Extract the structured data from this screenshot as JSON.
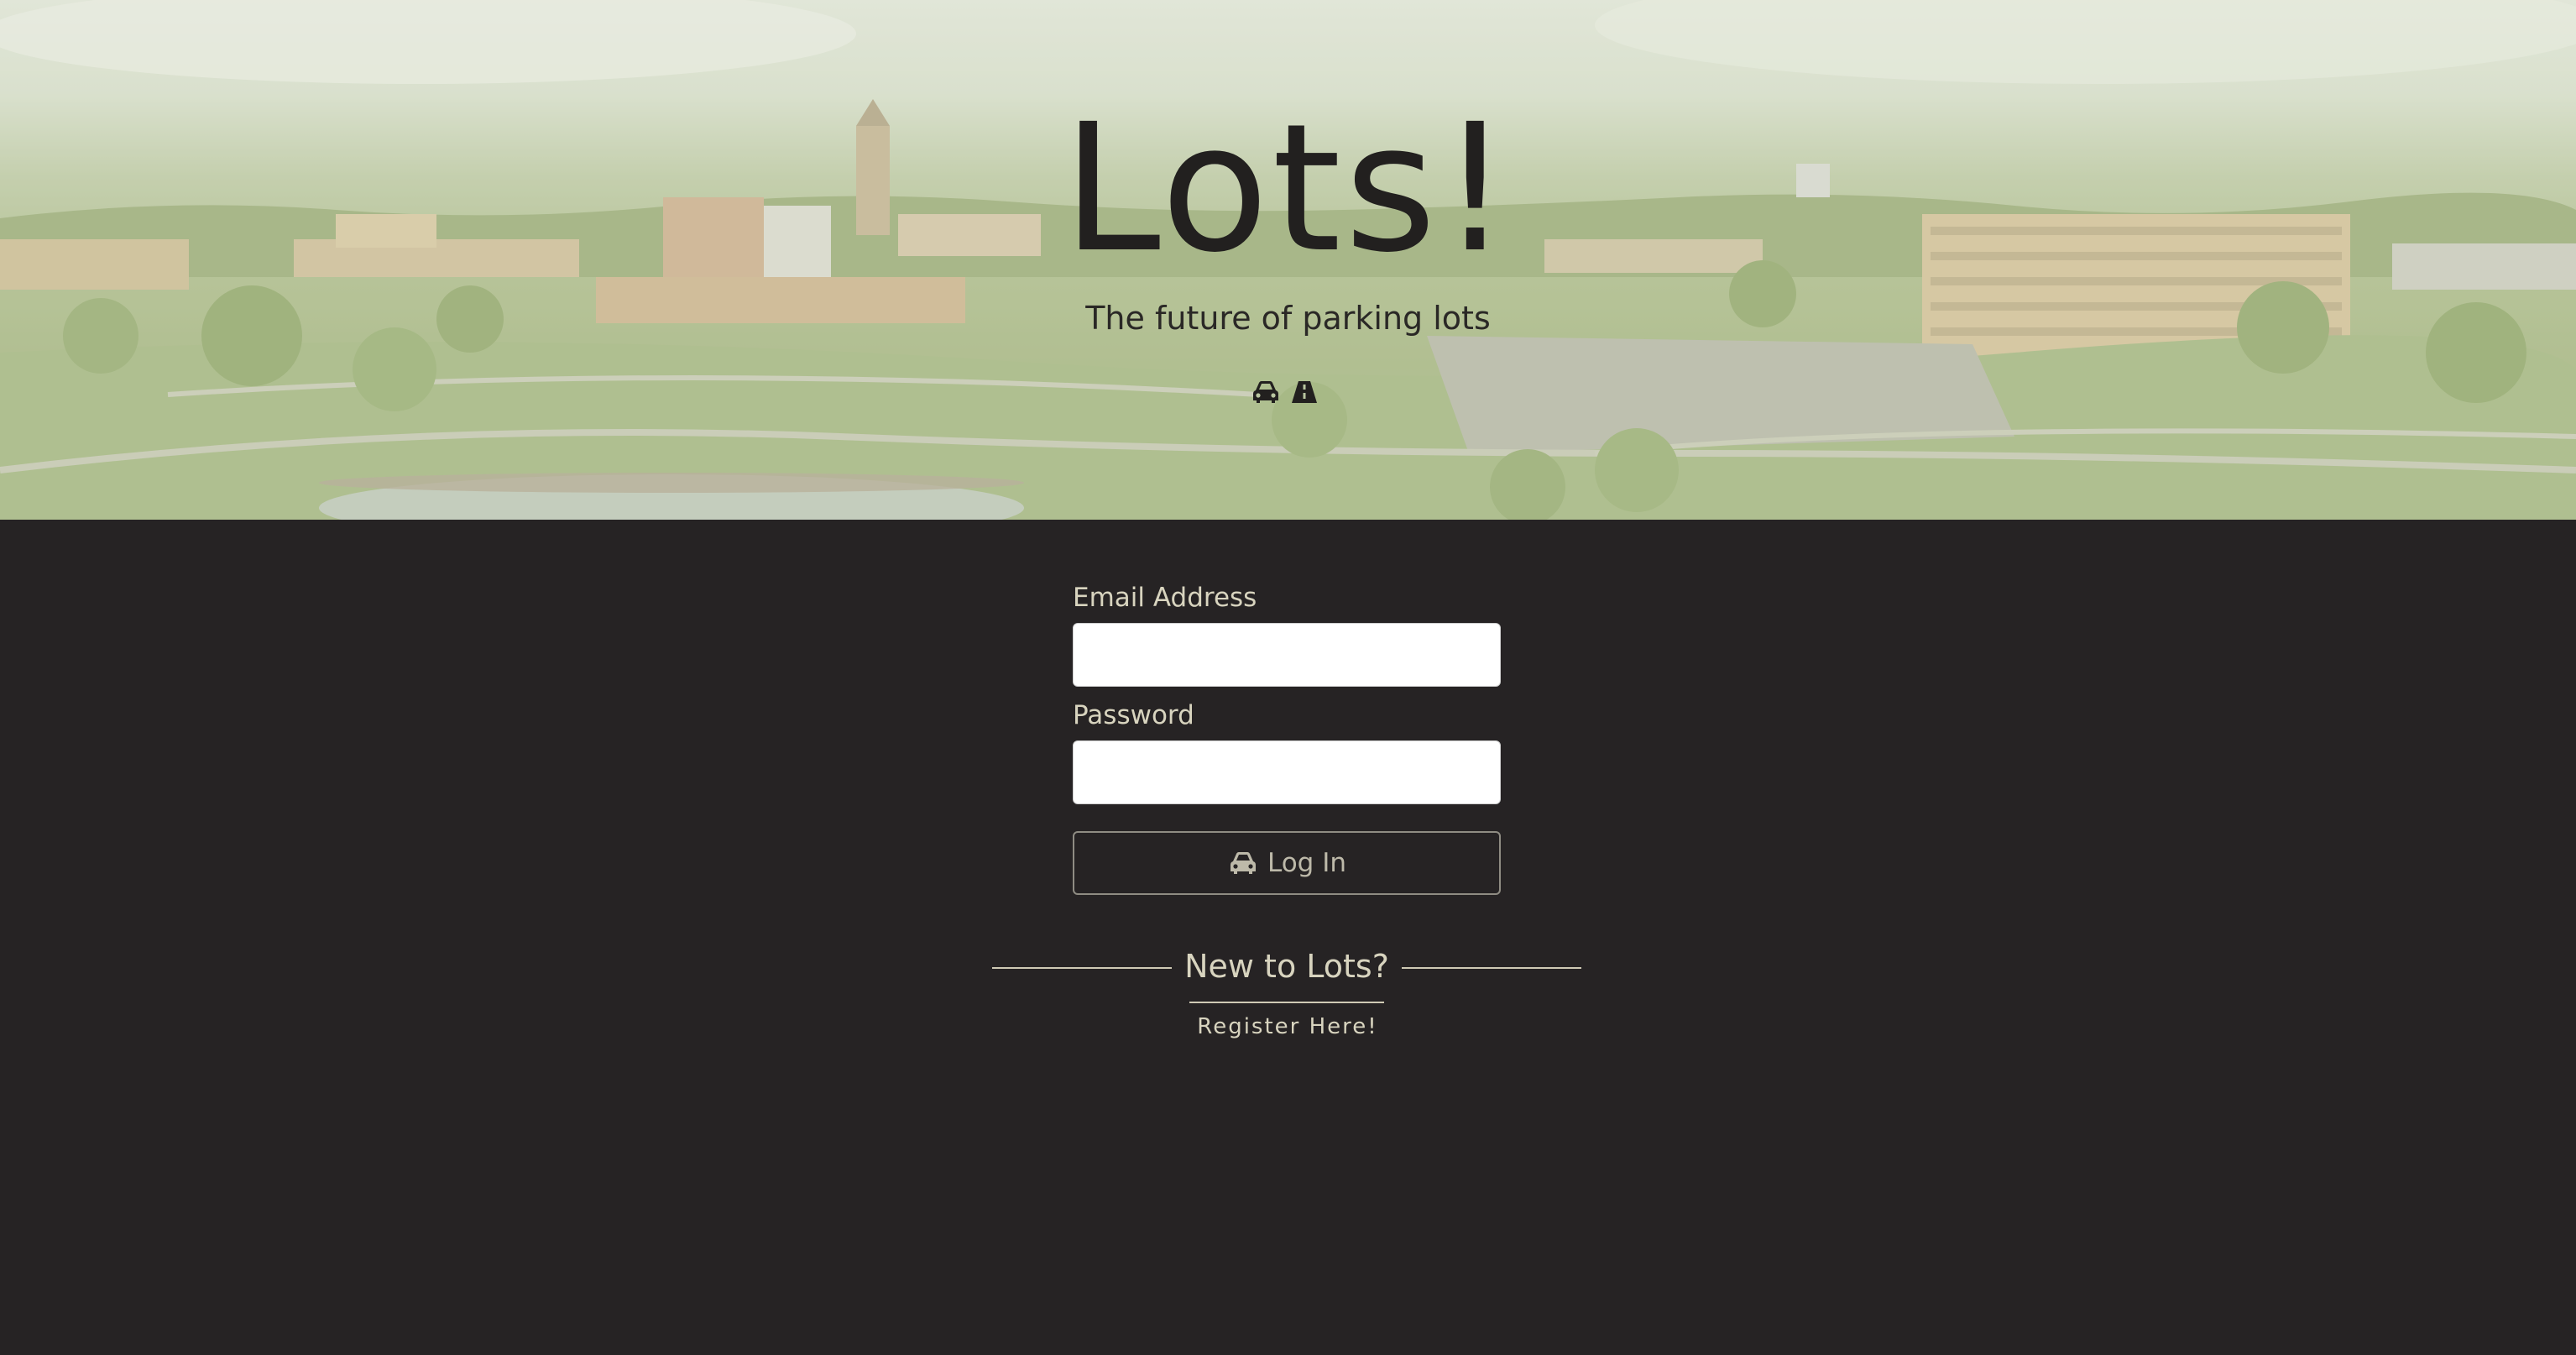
{
  "hero": {
    "title": "Lots!",
    "subtitle": "The future of parking lots",
    "icons": [
      "car-icon",
      "road-icon"
    ]
  },
  "login_form": {
    "email_label": "Email Address",
    "email_value": "",
    "password_label": "Password",
    "password_value": "",
    "login_button_label": "Log In",
    "login_button_icon": "car-icon"
  },
  "register": {
    "heading": "New to Lots?",
    "link_label": "Register Here!"
  },
  "colors": {
    "page_background": "#262324",
    "accent_text": "#d8d4bf",
    "title_text": "#22201f"
  }
}
